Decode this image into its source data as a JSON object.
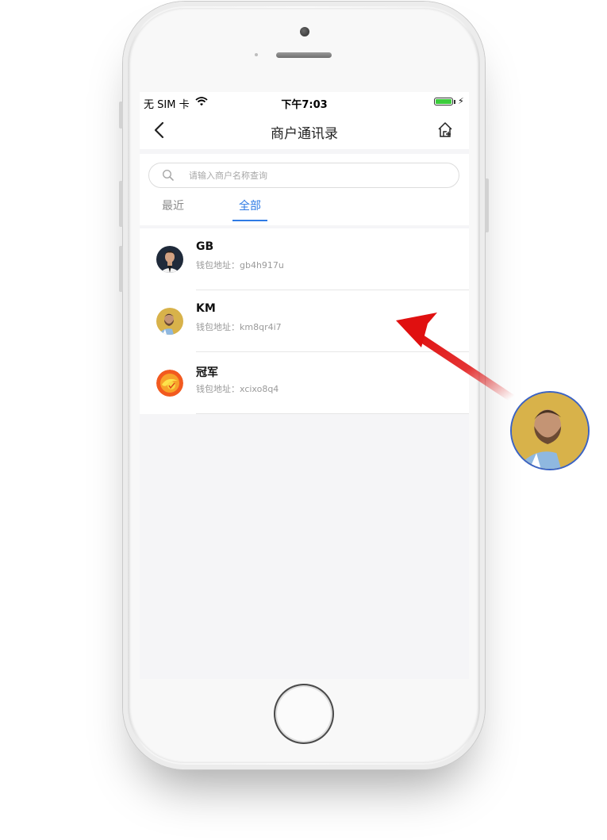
{
  "status_bar": {
    "carrier": "无 SIM 卡",
    "time": "下午7:03",
    "battery_color": "#3ccd3c"
  },
  "navbar": {
    "title": "商户通讯录",
    "back_icon": "chevron-left-icon",
    "home_icon": "home-add-icon"
  },
  "search": {
    "placeholder": "请输入商户名称查询",
    "value": ""
  },
  "tabs": [
    {
      "label": "最近",
      "active": false
    },
    {
      "label": "全部",
      "active": true
    }
  ],
  "accent_color": "#2f7be5",
  "contacts": [
    {
      "name": "GB",
      "address": "钱包地址：gb4h917u",
      "avatar": "player-dark-jersey-avatar"
    },
    {
      "name": "KM",
      "address": "钱包地址：km8qr4i7",
      "avatar": "player-gold-background-avatar"
    },
    {
      "name": "冠军",
      "address": "钱包地址：xcixo8q4",
      "avatar": "orange-swirl-avatar"
    }
  ],
  "annotation": {
    "arrow_color": "#e01010",
    "highlight_avatar": "player-gold-background-avatar",
    "highlight_border": "#3b63c4"
  }
}
